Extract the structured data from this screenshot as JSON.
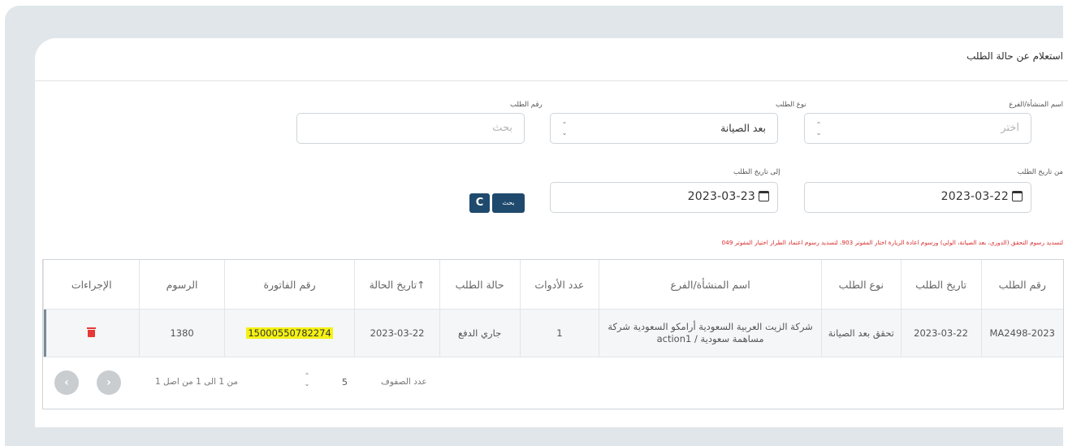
{
  "header": {
    "title": "استعلام عن حالة الطلب"
  },
  "form": {
    "facility": {
      "label": "اسم المنشأة/الفرع",
      "placeholder": "اختر"
    },
    "request_type": {
      "label": "نوع الطلب",
      "value": "بعد الصيانة"
    },
    "request_no": {
      "label": "رقم الطلب",
      "placeholder": "بحث"
    },
    "date_from": {
      "label": "من تاريخ الطلب",
      "value": "2023-03-22"
    },
    "date_to": {
      "label": "إلى تاريخ الطلب",
      "value": "2023-03-23"
    },
    "search_label": "بحث",
    "refresh_label": "C"
  },
  "note": "لتسديد رسوم التحقق (الدوري، بعد الصيانة، الولي) ورسوم اعادة الزيارة اختار المفوتر 903، لتسديد رسوم اعتماد الطراز اختيار المفوتر 049",
  "table": {
    "headers": {
      "request_no": "رقم الطلب",
      "request_date": "تاريخ الطلب",
      "request_type": "نوع الطلب",
      "facility": "اسم المنشأة/الفرع",
      "tools": "عدد الأدوات",
      "status": "حالة الطلب",
      "status_date": "تاريخ الحالة",
      "invoice": "رقم الفاتورة",
      "fees": "الرسوم",
      "actions": "الإجراءات"
    },
    "sort_icon": "arrow-up-icon",
    "rows": [
      {
        "request_no": "MA2498-2023",
        "request_date": "2023-03-22",
        "request_type": "تحقق بعد الصيانة",
        "facility": "شركة الزيت العربية السعودية أرامكو السعودية شركة مساهمة سعودية / action1",
        "tools": "1",
        "status": "جاري الدفع",
        "status_date": "2023-03-22",
        "invoice": "15000550782274",
        "fees": "1380",
        "action_icon": "trash-icon"
      }
    ]
  },
  "pager": {
    "rows_label": "عدد الصفوف",
    "rows_value": "5",
    "info": "من 1 الى 1 من اصل 1",
    "prev_icon": "chevron-left-icon",
    "next_icon": "chevron-right-icon"
  },
  "colors": {
    "primary": "#1f4a6e",
    "note": "#d62b2b",
    "highlight": "#f4f113",
    "delete": "#e53935"
  }
}
